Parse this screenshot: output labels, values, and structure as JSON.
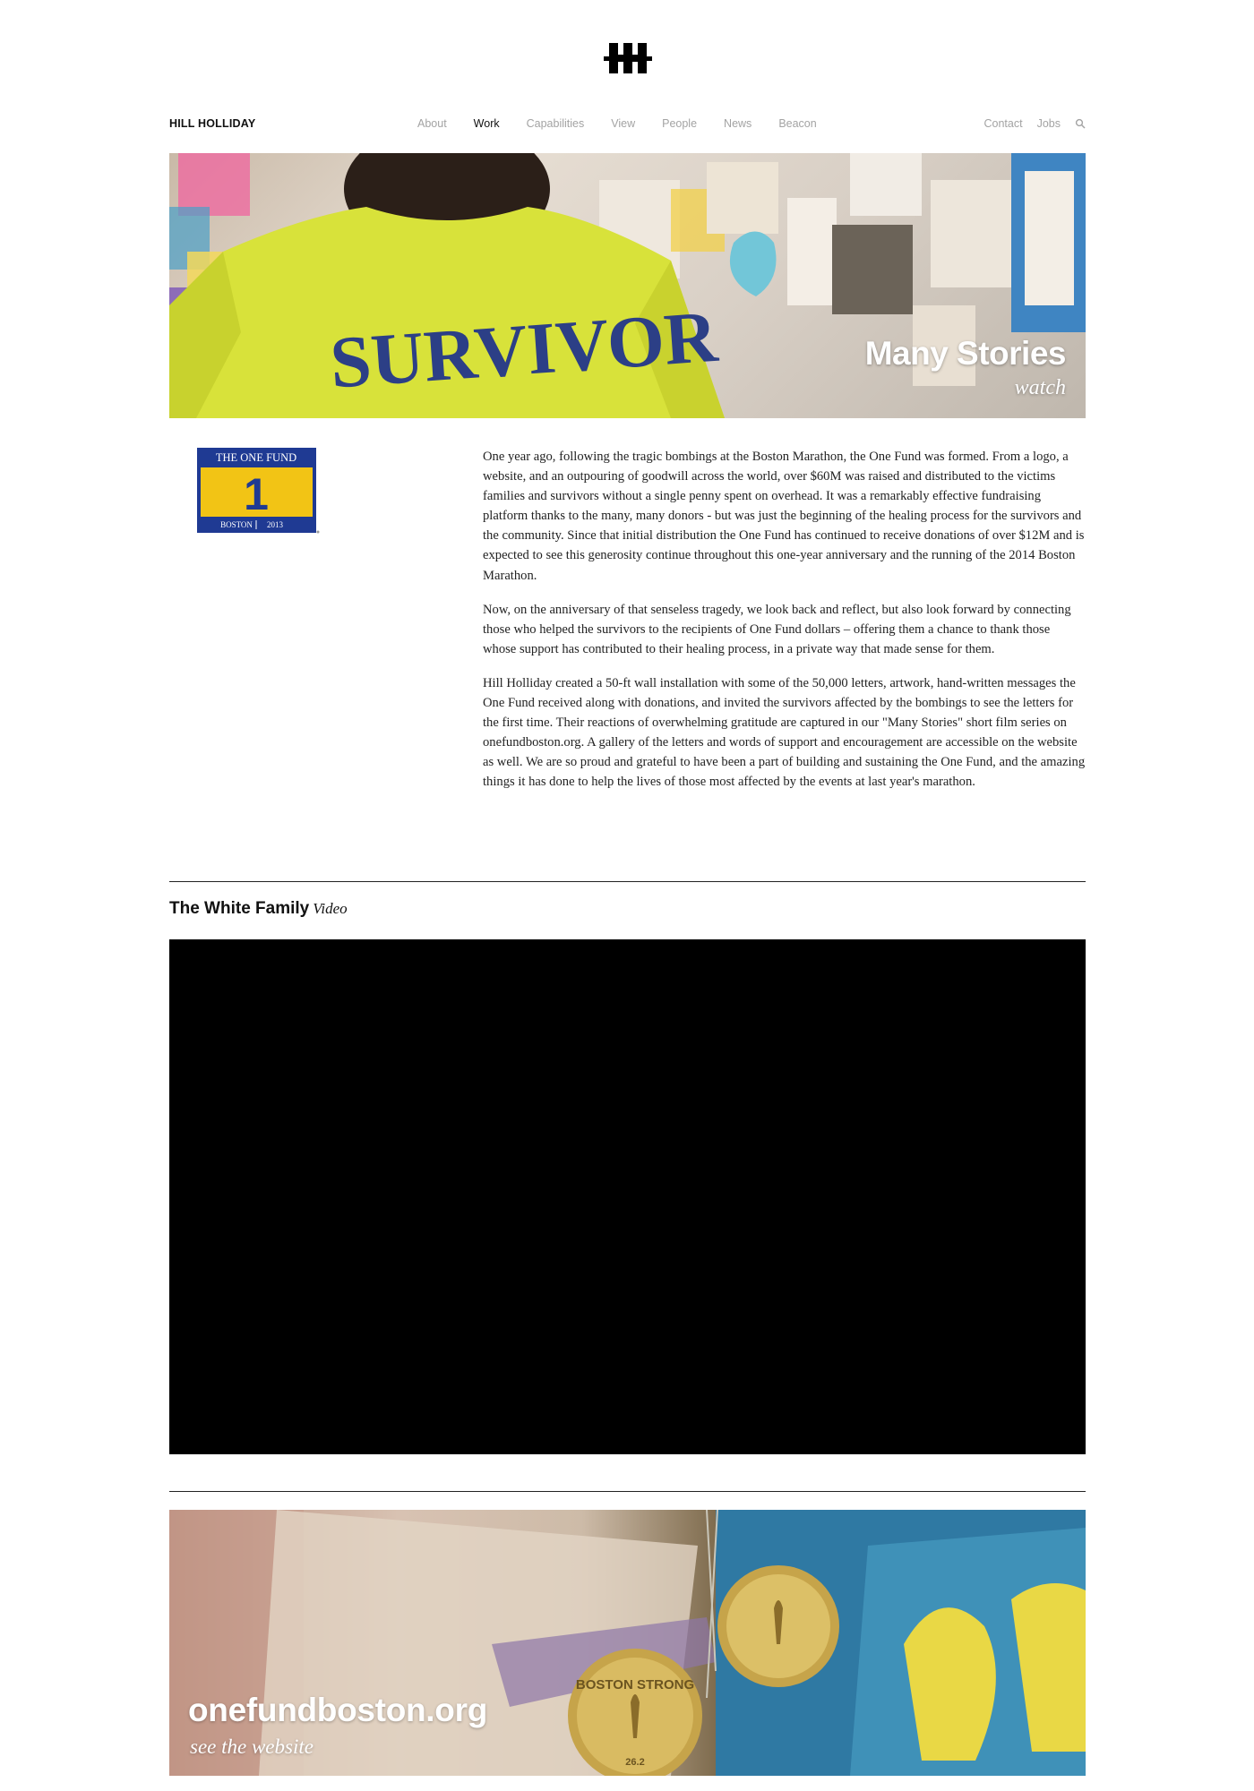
{
  "header": {
    "logo_icon": "hh-monogram-logo",
    "brand": "HILL HOLLIDAY"
  },
  "nav": {
    "main": [
      {
        "label": "About",
        "active": false
      },
      {
        "label": "Work",
        "active": true
      },
      {
        "label": "Capabilities",
        "active": false
      },
      {
        "label": "View",
        "active": false
      },
      {
        "label": "People",
        "active": false
      },
      {
        "label": "News",
        "active": false
      },
      {
        "label": "Beacon",
        "active": false
      }
    ],
    "secondary": [
      {
        "label": "Contact"
      },
      {
        "label": "Jobs"
      }
    ],
    "search_icon": "search-icon"
  },
  "hero": {
    "shirt_text": "SURVIVOR",
    "title": "Many Stories",
    "subtitle": "watch"
  },
  "onefund_logo": {
    "top_text": "THE ONE FUND",
    "number": "1",
    "bottom_left": "BOSTON",
    "bottom_right": "2013"
  },
  "article": {
    "paragraphs": [
      "One year ago, following the tragic bombings at the Boston Marathon, the One Fund was formed. From a logo, a website, and an outpouring of goodwill across the world, over $60M was raised and distributed to the victims families and survivors without a single penny spent on overhead. It was a remarkably effective fundraising platform thanks to the many, many donors - but was just the beginning of the healing process for the survivors and the community. Since that initial distribution the One Fund has continued to receive donations of over $12M and is expected to see this generosity continue throughout this one-year anniversary and the running of the 2014 Boston Marathon.",
      "Now, on the anniversary of that senseless tragedy, we look back and reflect, but also look forward by connecting those who helped the survivors to the recipients of One Fund dollars – offering them a chance to thank those whose support has contributed to their healing process, in a private way that made sense for them.",
      "Hill Holliday created a 50-ft wall installation with some of the 50,000 letters, artwork, hand-written messages the One Fund received along with donations, and invited the survivors affected by the bombings to see the letters for the first time. Their reactions of overwhelming gratitude are captured in our \"Many Stories\" short film series on onefundboston.org. A gallery of the letters and words of support and encouragement are accessible on the website as well. We are so proud and grateful to have been a part of building and sustaining the One Fund, and the amazing things it has done to help the lives of those most affected by the events at last year's marathon."
    ]
  },
  "video_section": {
    "title": "The White Family",
    "tag": "Video"
  },
  "promo": {
    "medal_text": "BOSTON STRONG",
    "medal_number": "26.2",
    "title": "onefundboston.org",
    "subtitle": "see the website"
  },
  "colors": {
    "nav_inactive": "#a3a3a3",
    "shirt_yellow": "#d8e23a",
    "onefund_blue": "#1f3a93",
    "onefund_gold": "#f2c415"
  }
}
